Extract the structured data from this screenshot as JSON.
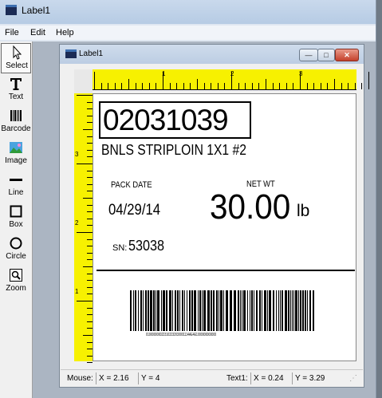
{
  "outer_window": {
    "title": "Label1"
  },
  "menu": {
    "items": [
      "File",
      "Edit",
      "Help"
    ]
  },
  "toolbox": {
    "tools": [
      {
        "label": "Select",
        "icon": "cursor-arrow-icon"
      },
      {
        "label": "Text",
        "icon": "text-t-icon"
      },
      {
        "label": "Barcode",
        "icon": "barcode-icon"
      },
      {
        "label": "Image",
        "icon": "image-icon"
      },
      {
        "label": "Line",
        "icon": "line-icon"
      },
      {
        "label": "Box",
        "icon": "box-icon"
      },
      {
        "label": "Circle",
        "icon": "circle-icon"
      },
      {
        "label": "Zoom",
        "icon": "zoom-magnifier-icon"
      }
    ]
  },
  "child_window": {
    "title": "Label1",
    "buttons": {
      "minimize": "minimize-icon",
      "maximize": "maximize-icon",
      "close": "close-icon"
    }
  },
  "rulers": {
    "top_numbers": [
      "1",
      "2",
      "3"
    ],
    "left_numbers": [
      "3",
      "2",
      "1"
    ],
    "color": "#f7f100"
  },
  "label": {
    "lot_number": "02031039",
    "product": "BNLS STRIPLOIN 1X1 #2",
    "pack_date_label": "PACK DATE",
    "pack_date": "04/29/14",
    "net_wt_label": "NET WT",
    "net_wt_value": "30.00",
    "net_wt_unit": "lb",
    "sn_label": "SN:",
    "sn_value": "53038",
    "barcode_text": "0190000000223102232030001114AE4E1000000000000"
  },
  "status_bar": {
    "mouse_label": "Mouse:",
    "mouse_x": "X = 2.16",
    "mouse_y": "Y = 4",
    "text_label": "Text1:",
    "text_x": "X = 0.24",
    "text_y": "Y = 3.29"
  }
}
